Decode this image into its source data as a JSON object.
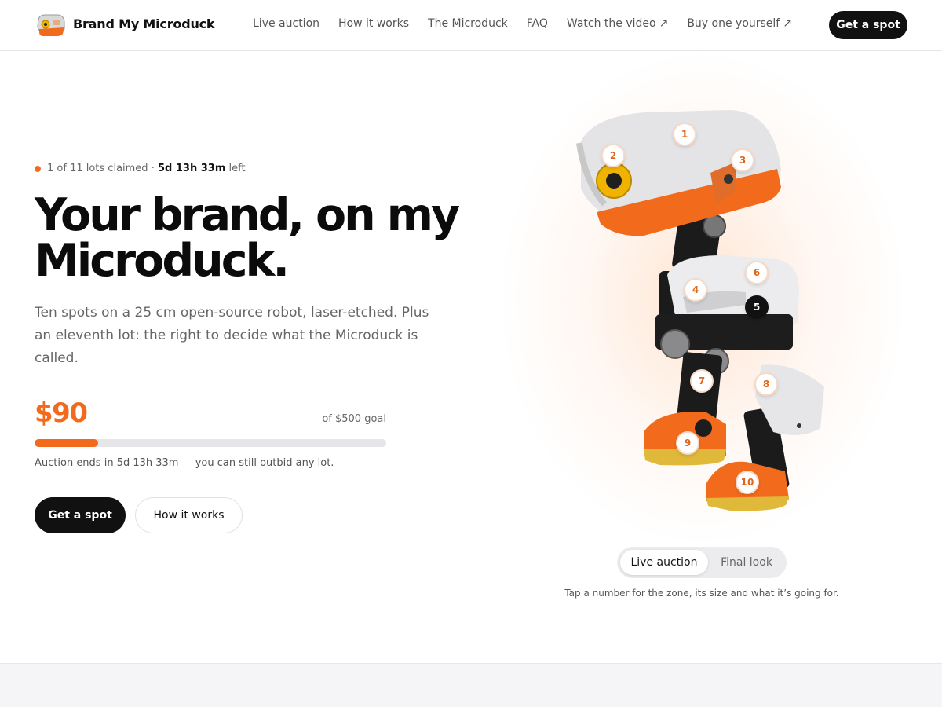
{
  "nav": {
    "brand": "Brand My Microduck",
    "logo_icon": "microduck-head-icon",
    "links": [
      {
        "label": "Live auction",
        "external": false
      },
      {
        "label": "How it works",
        "external": false
      },
      {
        "label": "The Microduck",
        "external": false
      },
      {
        "label": "FAQ",
        "external": false
      },
      {
        "label": "Watch the video",
        "external": true
      },
      {
        "label": "Buy one yourself",
        "external": true
      }
    ],
    "external_glyph": "↗",
    "cta": "Get a spot"
  },
  "hero": {
    "status": {
      "claimed": "1 of 11 lots claimed",
      "separator": "·",
      "time_left": "5d 13h 33m",
      "suffix": "left"
    },
    "headline": [
      "Your brand, on my",
      "Microduck."
    ],
    "subtitle": "Ten spots on a 25 cm open-source robot, laser-etched. Plus an eleventh lot: the right to decide what the Microduck is called.",
    "raised": "$90",
    "goal": "of $500 goal",
    "progress_fraction": 0.18,
    "ends": "Auction ends in 5d 13h 33m — you can still outbid any lot.",
    "primary_button": "Get a spot",
    "secondary_button": "How it works"
  },
  "viewer": {
    "hotspots": [
      "1",
      "2",
      "3",
      "4",
      "5",
      "6",
      "7",
      "8",
      "9",
      "10"
    ],
    "active_hotspot": "5",
    "toggle": {
      "live": "Live auction",
      "final": "Final look",
      "selected": "live"
    },
    "hint": "Tap a number for the zone, its size and what it’s going for."
  },
  "colors": {
    "accent": "#f26b1d",
    "text": "#111111",
    "muted": "#666666",
    "track": "#e6e6ea"
  }
}
